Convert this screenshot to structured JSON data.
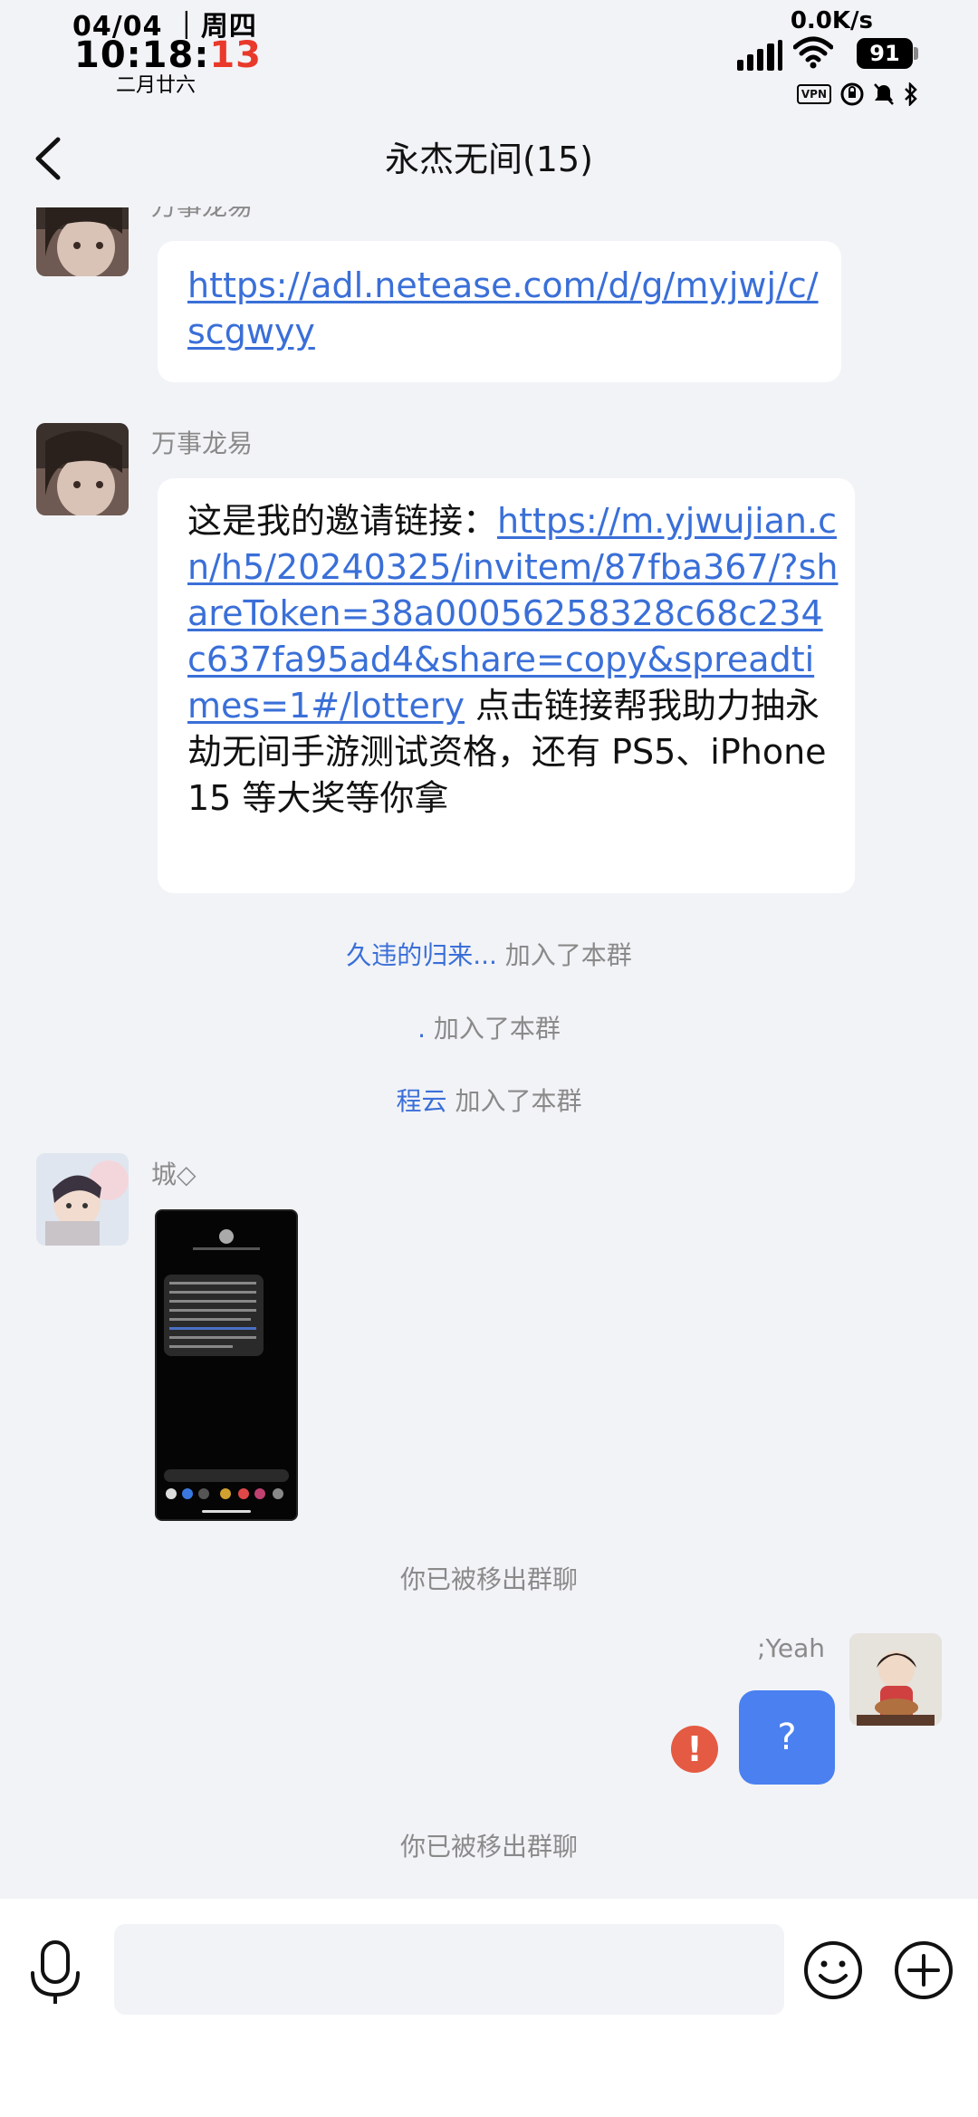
{
  "status_bar": {
    "date": "04/04 ｜周四",
    "time_main": "10:18:",
    "time_seconds": "13",
    "lunar_date": "二月廿六",
    "net_speed": "0.0K/s",
    "battery": "91",
    "vpn_label": "VPN"
  },
  "header": {
    "title": "永杰无间(15)"
  },
  "messages": {
    "m1": {
      "sender": "万事龙易",
      "link": "https://adl.netease.com/d/g/myjwj/c/scgwyy"
    },
    "m2": {
      "sender": "万事龙易",
      "prefix": "这是我的邀请链接：",
      "link": "https://m.yjwujian.cn/h5/20240325/invitem/87fba367/?shareToken=38a00056258328c68c234c637fa95ad4&share=copy&spreadtimes=1#/lottery",
      "suffix": " 点击链接帮我助力抽永劫无间手游测试资格，还有 PS5、iPhone15 等大奖等你拿"
    },
    "sys1": {
      "name": "久违的归来...",
      "text": " 加入了本群"
    },
    "sys2": {
      "name": ".",
      "text": " 加入了本群"
    },
    "sys3": {
      "name": "程云",
      "text": " 加入了本群"
    },
    "m3": {
      "sender": "城◇"
    },
    "sys4": {
      "text": "你已被移出群聊"
    },
    "m4": {
      "sender": ";Yeah",
      "text": "?"
    },
    "sys5": {
      "text": "你已被移出群聊"
    }
  },
  "input": {
    "value": "",
    "placeholder": ""
  },
  "colors": {
    "background": "#f2f3f7",
    "link": "#3a6fd8",
    "my_bubble": "#4a80f0",
    "error": "#e45a42",
    "clock_seconds": "#e8392b"
  },
  "icons": [
    "back-chevron-icon",
    "signal-icon",
    "wifi-icon",
    "battery-icon",
    "vpn-icon",
    "rotation-lock-icon",
    "mute-icon",
    "bluetooth-icon",
    "microphone-icon",
    "emoji-icon",
    "plus-icon",
    "error-icon"
  ]
}
